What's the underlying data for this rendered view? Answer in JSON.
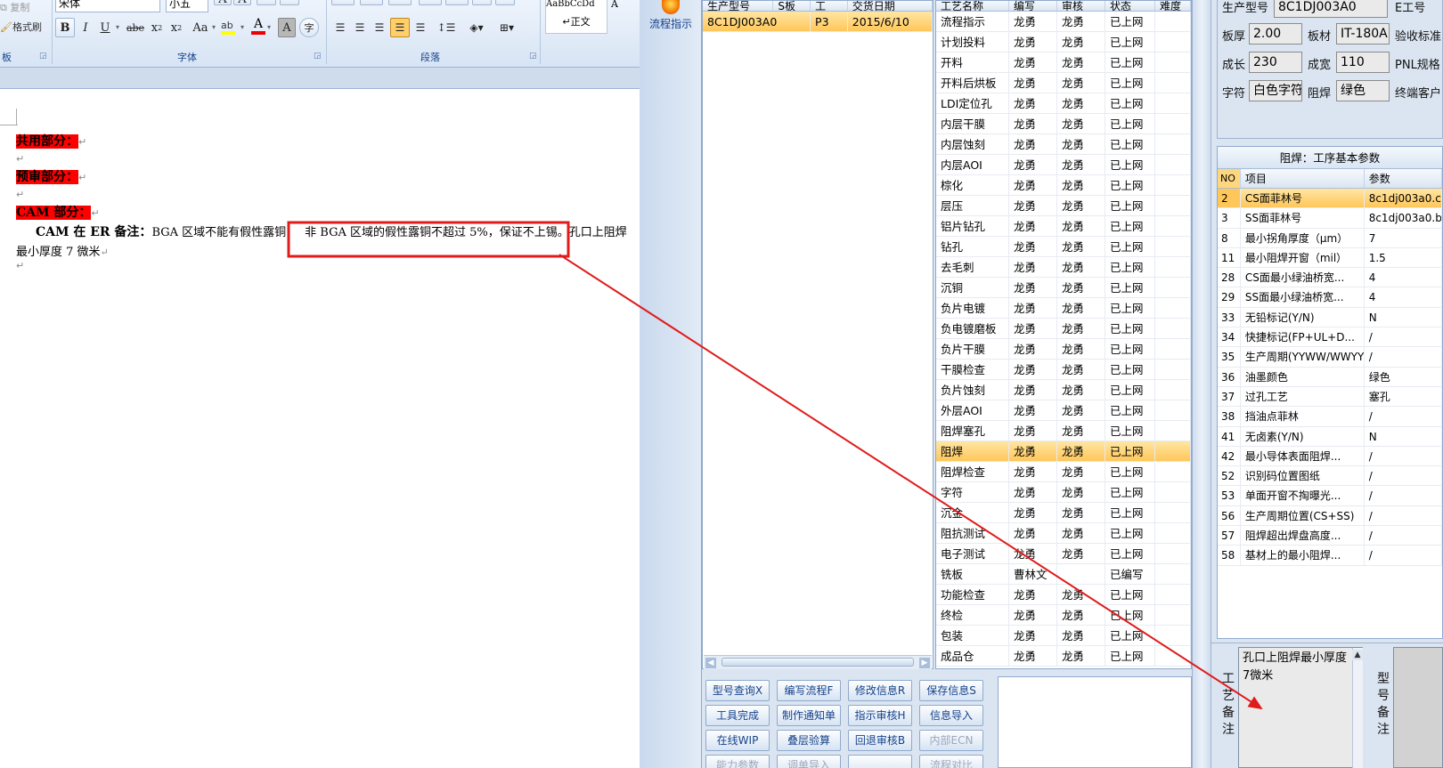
{
  "word": {
    "ribbon": {
      "clipboard": {
        "copy": "复制",
        "format_painter": "格式刷",
        "group_label": "板"
      },
      "font": {
        "font_name": "宋体",
        "font_size": "小五",
        "group_label": "字体"
      },
      "paragraph": {
        "group_label": "段落"
      },
      "styles": {
        "preview": "AaBbCcDd",
        "normal": "↵正文",
        "extra": "A"
      }
    },
    "doc": {
      "line1": "共用部分：",
      "line2": "预审部分：",
      "line3": "CAM 部分：",
      "note_label": "CAM 在 ER 备注：",
      "note_part1": "BGA 区域不能有假性露铜，",
      "note_part2": "非 BGA 区域的假性露铜不超过 5%，保证不上锡。",
      "note_part3": "孔口上阻焊",
      "note_line2": "最小厚度 7 微米",
      "para_mark": "↵"
    }
  },
  "app": {
    "flow_button": "流程指示",
    "models": {
      "headers": [
        "生产型号",
        "S板",
        "工",
        "交货日期"
      ],
      "rows": [
        {
          "model": "8C1DJ003A0",
          "code": "P3",
          "date": "2015/6/10"
        }
      ]
    },
    "steps": {
      "headers": [
        "工艺名称",
        "编写",
        "审核",
        "状态",
        "难度"
      ],
      "selected_index": 22,
      "rows": [
        [
          "流程指示",
          "龙勇",
          "龙勇",
          "已上网",
          ""
        ],
        [
          "计划投料",
          "龙勇",
          "龙勇",
          "已上网",
          ""
        ],
        [
          "开料",
          "龙勇",
          "龙勇",
          "已上网",
          ""
        ],
        [
          "开料后烘板",
          "龙勇",
          "龙勇",
          "已上网",
          ""
        ],
        [
          "LDI定位孔",
          "龙勇",
          "龙勇",
          "已上网",
          ""
        ],
        [
          "内层干膜",
          "龙勇",
          "龙勇",
          "已上网",
          ""
        ],
        [
          "内层蚀刻",
          "龙勇",
          "龙勇",
          "已上网",
          ""
        ],
        [
          "内层AOI",
          "龙勇",
          "龙勇",
          "已上网",
          ""
        ],
        [
          "棕化",
          "龙勇",
          "龙勇",
          "已上网",
          ""
        ],
        [
          "层压",
          "龙勇",
          "龙勇",
          "已上网",
          ""
        ],
        [
          "铝片钻孔",
          "龙勇",
          "龙勇",
          "已上网",
          ""
        ],
        [
          "钻孔",
          "龙勇",
          "龙勇",
          "已上网",
          ""
        ],
        [
          "去毛刺",
          "龙勇",
          "龙勇",
          "已上网",
          ""
        ],
        [
          "沉铜",
          "龙勇",
          "龙勇",
          "已上网",
          ""
        ],
        [
          "负片电镀",
          "龙勇",
          "龙勇",
          "已上网",
          ""
        ],
        [
          "负电镀磨板",
          "龙勇",
          "龙勇",
          "已上网",
          ""
        ],
        [
          "负片干膜",
          "龙勇",
          "龙勇",
          "已上网",
          ""
        ],
        [
          "干膜检查",
          "龙勇",
          "龙勇",
          "已上网",
          ""
        ],
        [
          "负片蚀刻",
          "龙勇",
          "龙勇",
          "已上网",
          ""
        ],
        [
          "外层AOI",
          "龙勇",
          "龙勇",
          "已上网",
          ""
        ],
        [
          "阻焊塞孔",
          "龙勇",
          "龙勇",
          "已上网",
          ""
        ],
        [
          "阻焊",
          "龙勇",
          "龙勇",
          "已上网",
          ""
        ],
        [
          "阻焊检查",
          "龙勇",
          "龙勇",
          "已上网",
          ""
        ],
        [
          "字符",
          "龙勇",
          "龙勇",
          "已上网",
          ""
        ],
        [
          "沉金",
          "龙勇",
          "龙勇",
          "已上网",
          ""
        ],
        [
          "阻抗测试",
          "龙勇",
          "龙勇",
          "已上网",
          ""
        ],
        [
          "电子测试",
          "龙勇",
          "龙勇",
          "已上网",
          ""
        ],
        [
          "铣板",
          "曹林文",
          "",
          "已编写",
          ""
        ],
        [
          "功能检查",
          "龙勇",
          "龙勇",
          "已上网",
          ""
        ],
        [
          "终检",
          "龙勇",
          "龙勇",
          "已上网",
          ""
        ],
        [
          "包装",
          "龙勇",
          "龙勇",
          "已上网",
          ""
        ],
        [
          "成品仓",
          "龙勇",
          "龙勇",
          "已上网",
          ""
        ]
      ]
    },
    "buttons": [
      [
        "型号查询X",
        "编写流程F",
        "修改信息R",
        "保存信息S"
      ],
      [
        "工具完成",
        "制作通知单",
        "指示审核H",
        "信息导入"
      ],
      [
        "在线WIP",
        "叠层验算",
        "回退审核B",
        "内部ECN"
      ],
      [
        "能力参数",
        "调单导入",
        "",
        "流程对比"
      ]
    ],
    "info": {
      "model_label": "生产型号",
      "model_value": "8C1DJ003A0",
      "eng_label": "E工号",
      "thickness_label": "板厚",
      "thickness_value": "2.00",
      "material_label": "板材",
      "material_value": "IT-180A",
      "accept_label": "验收标准",
      "length_label": "成长",
      "length_value": "230",
      "width_label": "成宽",
      "width_value": "110",
      "pnl_label": "PNL规格",
      "char_label": "字符",
      "char_value": "白色字符",
      "mask_label": "阻焊",
      "mask_value": "绿色",
      "customer_label": "终端客户"
    },
    "params": {
      "title": "阻焊：工序基本参数",
      "headers": [
        "NO",
        "项目",
        "参数"
      ],
      "rows": [
        [
          "2",
          "CS面菲林号",
          "8c1dj003a0.c"
        ],
        [
          "3",
          "SS面菲林号",
          "8c1dj003a0.b"
        ],
        [
          "8",
          "最小拐角厚度（μm）",
          "7"
        ],
        [
          "11",
          "最小阻焊开窗（mil）",
          "1.5"
        ],
        [
          "28",
          "CS面最小绿油桥宽...",
          "4"
        ],
        [
          "29",
          "SS面最小绿油桥宽...",
          "4"
        ],
        [
          "33",
          "无铅标记(Y/N)",
          "N"
        ],
        [
          "34",
          "快捷标记(FP+UL+D...",
          "/"
        ],
        [
          "35",
          "生产周期(YYWW/WWYY)",
          "/"
        ],
        [
          "36",
          "油墨颜色",
          "绿色"
        ],
        [
          "37",
          "过孔工艺",
          "塞孔"
        ],
        [
          "38",
          "挡油点菲林",
          "/"
        ],
        [
          "41",
          "无卤素(Y/N)",
          "N"
        ],
        [
          "42",
          "最小导体表面阻焊...",
          "/"
        ],
        [
          "52",
          "识别码位置图纸",
          "/"
        ],
        [
          "53",
          "单面开窗不掏曝光...",
          "/"
        ],
        [
          "56",
          "生产周期位置(CS+SS)",
          "/"
        ],
        [
          "57",
          "阻焊超出焊盘高度...",
          "/"
        ],
        [
          "58",
          "基材上的最小阻焊...",
          "/"
        ]
      ]
    },
    "remarks": {
      "process_label": "工艺备注",
      "process_text": "孔口上阻焊最小厚度7微米",
      "model_label": "型号备注"
    },
    "annotation_color": "#e01b1b"
  }
}
